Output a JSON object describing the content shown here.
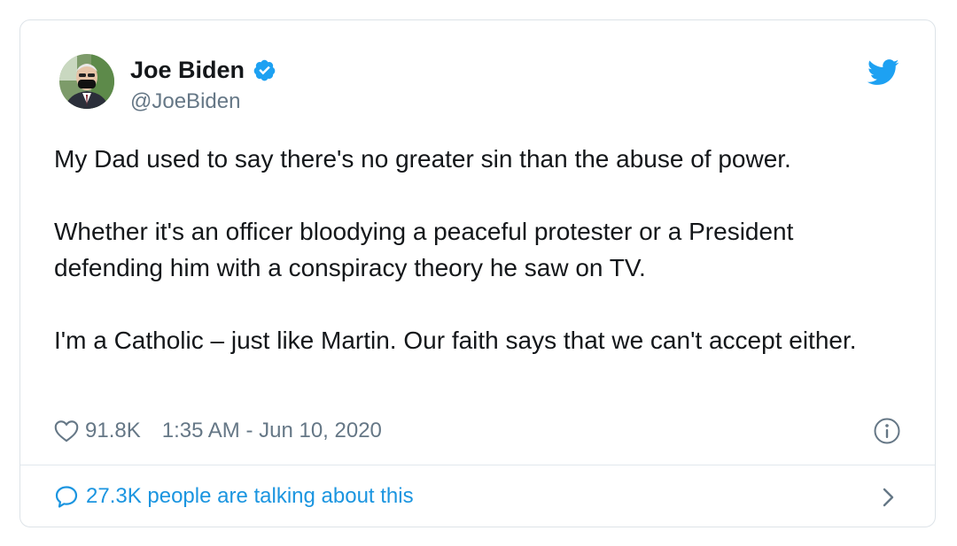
{
  "author": {
    "name": "Joe Biden",
    "handle": "@JoeBiden"
  },
  "tweet": {
    "paragraphs": [
      "My Dad used to say there's no greater sin than the abuse of power.",
      "Whether it's an officer bloodying a peaceful protester or a President defending him with a conspiracy theory he saw on TV.",
      "I'm a Catholic – just like Martin. Our faith says that we can't accept either."
    ],
    "likes": "91.8K",
    "timestamp": "1:35 AM - Jun 10, 2020"
  },
  "footer": {
    "talking": "27.3K people are talking about this"
  },
  "colors": {
    "accent": "#1da1f2",
    "link": "#1b95e0",
    "muted": "#657786",
    "text": "#14171a"
  },
  "icons": [
    "verified-badge-icon",
    "twitter-bird-icon",
    "heart-icon",
    "info-icon",
    "comment-bubble-icon",
    "chevron-right-icon"
  ]
}
